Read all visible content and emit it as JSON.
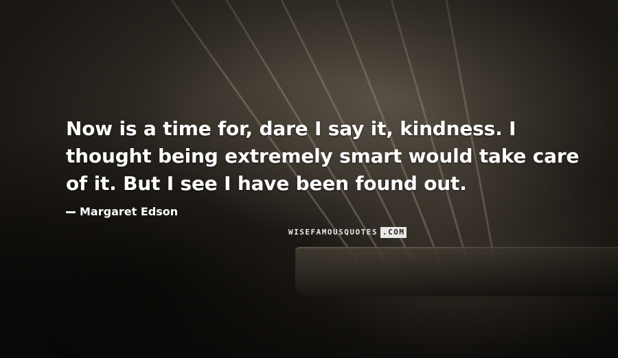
{
  "quote": {
    "text": "Now is a time for, dare I say it, kindness. I thought being extremely smart would take care of it. But I see I have been found out."
  },
  "author": {
    "name": "Margaret Edson"
  },
  "watermark": {
    "brand": "WISEFAMOUSQUOTES",
    "tld": ".COM"
  },
  "background": {
    "scene": "guitar-strings-icon",
    "tone": "#2c2721"
  }
}
